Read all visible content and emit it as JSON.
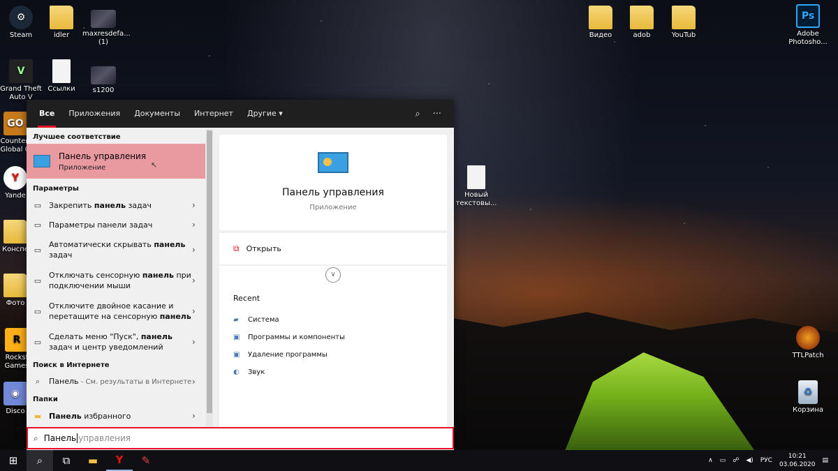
{
  "desktop": {
    "icons": [
      {
        "label": "Steam",
        "glyph": "⚙"
      },
      {
        "label": "idler",
        "glyph": ""
      },
      {
        "label": "maxresdefa... (1)",
        "glyph": ""
      },
      {
        "label": "Grand Theft Auto V",
        "glyph": "V"
      },
      {
        "label": "Ссылки",
        "glyph": ""
      },
      {
        "label": "s1200",
        "glyph": ""
      },
      {
        "label": "Counter-Global O",
        "glyph": "GO"
      },
      {
        "label": "Yande",
        "glyph": "Y"
      },
      {
        "label": "Конспе",
        "glyph": ""
      },
      {
        "label": "Фото",
        "glyph": ""
      },
      {
        "label": "Rockst Games",
        "glyph": "R"
      },
      {
        "label": "Disco",
        "glyph": "◉"
      },
      {
        "label": "Видео",
        "glyph": ""
      },
      {
        "label": "adob",
        "glyph": ""
      },
      {
        "label": "YouTub",
        "glyph": ""
      },
      {
        "label": "Adobe Photosho...",
        "glyph": "Ps"
      },
      {
        "label": "Новый текстовы...",
        "glyph": ""
      },
      {
        "label": "TTLPatch",
        "glyph": ""
      },
      {
        "label": "Корзина",
        "glyph": "♻"
      }
    ]
  },
  "search_panel": {
    "tabs": [
      "Все",
      "Приложения",
      "Документы",
      "Интернет",
      "Другие ▾"
    ],
    "icons": {
      "feedback": "⌕",
      "more": "···"
    },
    "best_match": {
      "section": "Лучшее соответствие",
      "title": "Панель управления",
      "subtitle": "Приложение"
    },
    "settings": {
      "section": "Параметры",
      "items": [
        {
          "pre": "Закрепить ",
          "bold": "панель",
          "post": " задач"
        },
        {
          "pre": "Параметры панели задач",
          "bold": "",
          "post": ""
        },
        {
          "pre": "Автоматически скрывать ",
          "bold": "панель",
          "post": " задач"
        },
        {
          "pre": "Отключать сенсорную ",
          "bold": "панель",
          "post": " при подключении мыши"
        },
        {
          "pre": "Отключите двойное касание и перетащите на сенсорную ",
          "bold": "панель",
          "post": ""
        },
        {
          "pre": "Сделать меню \"Пуск\", ",
          "bold": "панель",
          "post": " задач и центр уведомлений"
        }
      ]
    },
    "web": {
      "section": "Поиск в Интернете",
      "item_main": "Панель",
      "item_sub": " - См. результаты в Интернете"
    },
    "folders": {
      "section": "Папки",
      "item_bold": "Панель",
      "item_rest": " избранного"
    },
    "preview": {
      "title": "Панель управления",
      "subtitle": "Приложение",
      "open_label": "Открыть",
      "recent_title": "Recent",
      "recent_items": [
        "Система",
        "Программы и компоненты",
        "Удаление программы",
        "Звук"
      ]
    },
    "search_box": {
      "typed": "Панель",
      "hint": " управления"
    }
  },
  "taskbar": {
    "lang": "РУС",
    "time": "10:21",
    "date": "03.06.2020"
  }
}
